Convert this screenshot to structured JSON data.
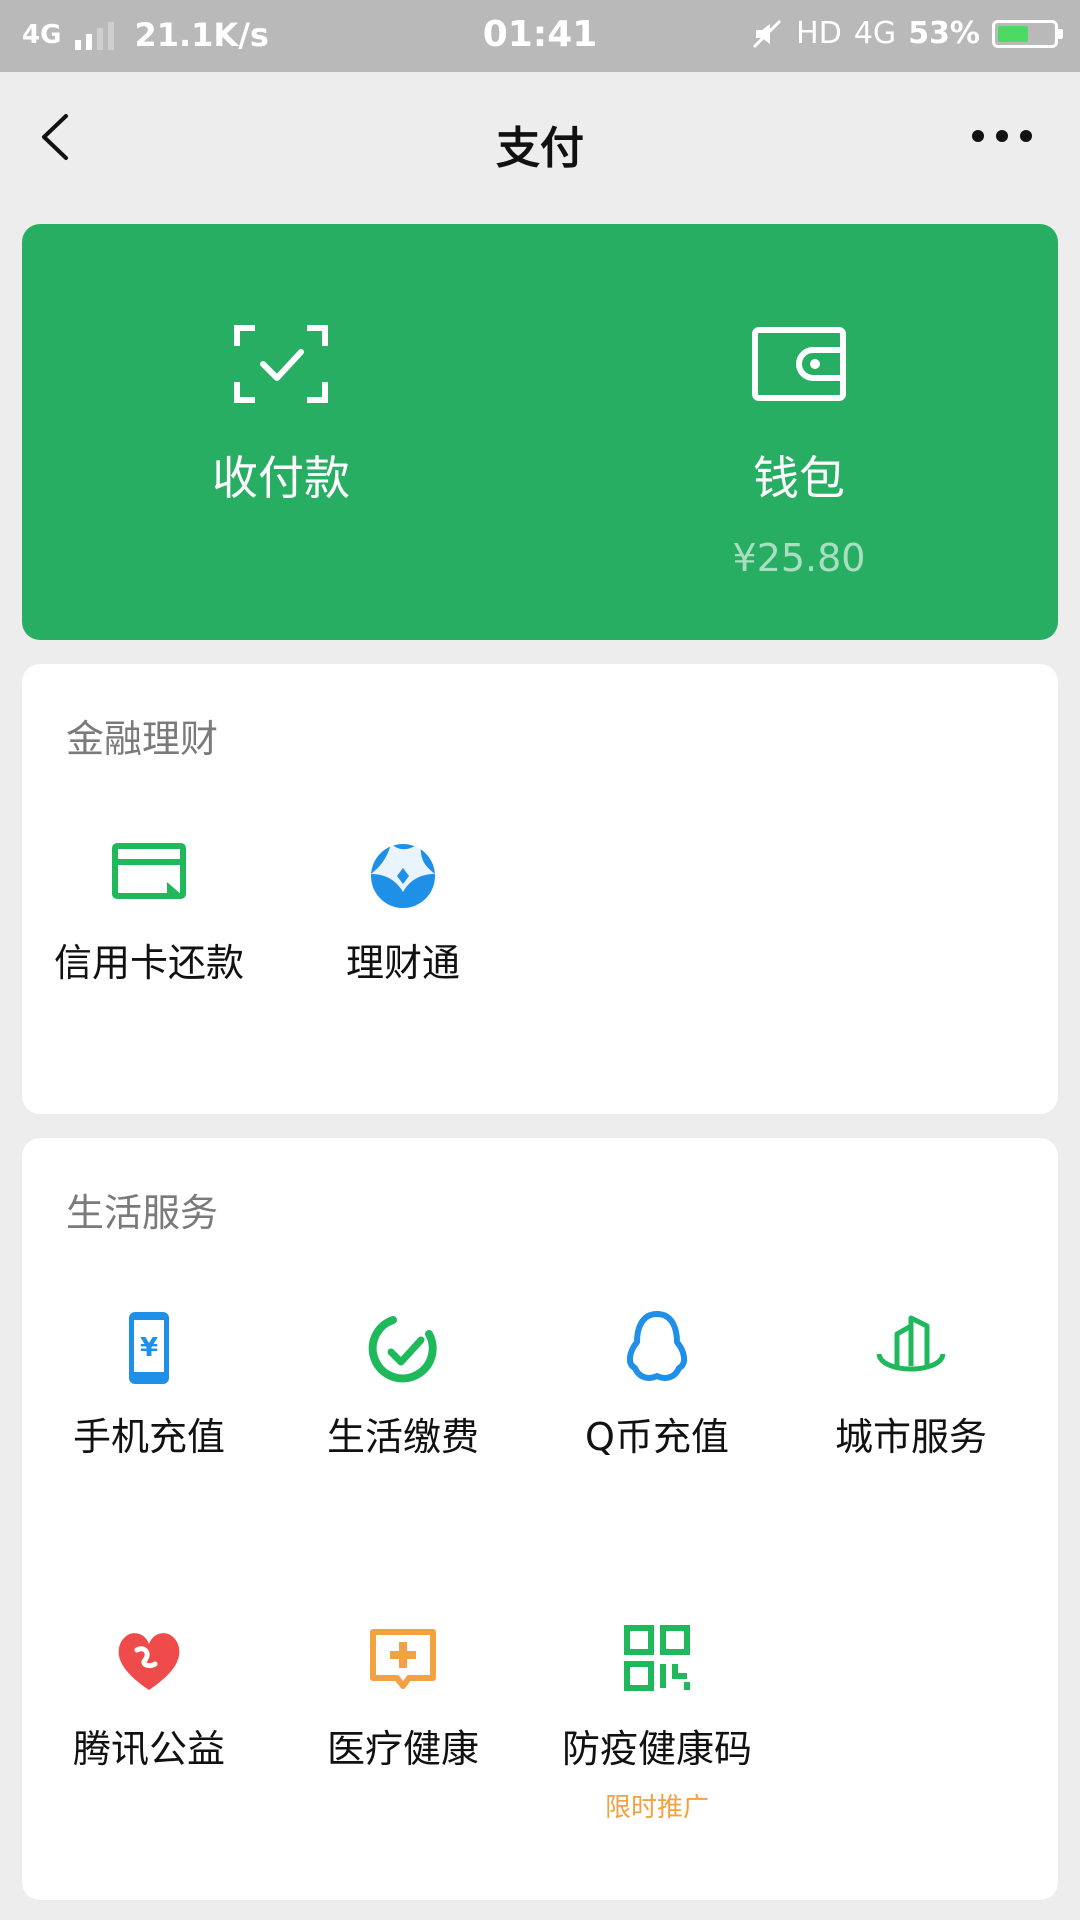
{
  "status_bar": {
    "network": "4G",
    "speed": "21.1K/s",
    "time": "01:41",
    "hd": "HD",
    "net2": "4G",
    "battery": "53%"
  },
  "nav": {
    "title": "支付",
    "back_icon": "chevron-left-icon",
    "more_icon": "more-icon"
  },
  "top_card": {
    "color": "#27ae63",
    "items": [
      {
        "label": "收付款",
        "icon": "scan-check-icon"
      },
      {
        "label": "钱包",
        "icon": "wallet-icon",
        "amount": "¥25.80"
      }
    ]
  },
  "finance": {
    "title": "金融理财",
    "items": [
      {
        "label": "信用卡还款",
        "icon": "credit-card-icon"
      },
      {
        "label": "理财通",
        "icon": "licaitong-icon"
      }
    ]
  },
  "life": {
    "title": "生活服务",
    "items": [
      {
        "label": "手机充值",
        "icon": "phone-recharge-icon"
      },
      {
        "label": "生活缴费",
        "icon": "bill-payment-icon"
      },
      {
        "label": "Q币充值",
        "icon": "qq-penguin-icon"
      },
      {
        "label": "城市服务",
        "icon": "city-service-icon"
      },
      {
        "label": "腾讯公益",
        "icon": "charity-heart-icon"
      },
      {
        "label": "医疗健康",
        "icon": "medical-icon"
      },
      {
        "label": "防疫健康码",
        "icon": "qr-code-icon",
        "badge": "限时推广"
      }
    ]
  },
  "colors": {
    "green": "#27ae63",
    "icon_green": "#1fb85b",
    "icon_blue": "#1e90e8",
    "icon_red": "#ef4b4b",
    "icon_orange": "#f2a23e"
  }
}
